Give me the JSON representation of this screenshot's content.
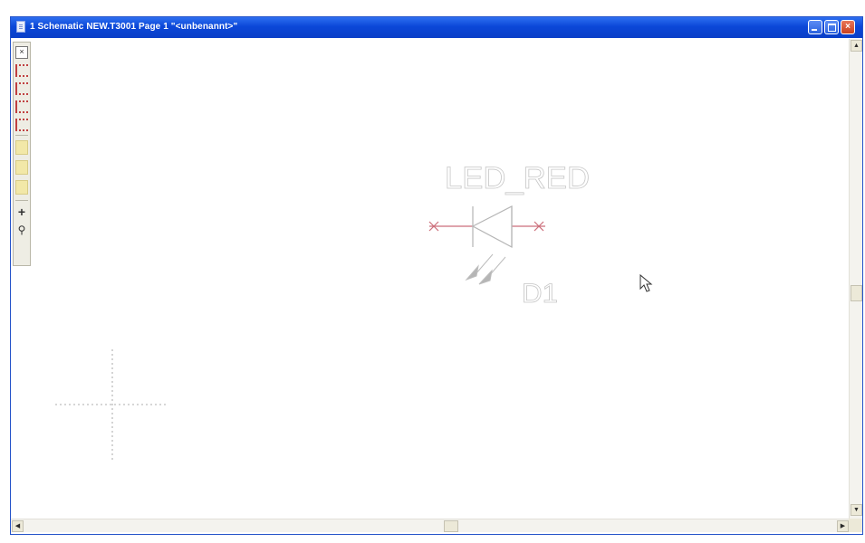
{
  "window": {
    "title": "1 Schematic NEW.T3001 Page 1 \"<unbenannt>\""
  },
  "window_controls": {
    "close_glyph": "×"
  },
  "toolbar": {
    "close_glyph": "×",
    "items": [
      "close-icon",
      "wire-tool-icon",
      "bus-tool-icon",
      "junction-tool-icon",
      "label-tool-icon",
      "text-tool-icon",
      "polygon-tool-icon",
      "add-part-icon",
      "search-part-icon"
    ]
  },
  "schematic": {
    "component_value": "LED_RED",
    "component_reference": "D1",
    "component_type": "LED",
    "accent_colors": {
      "pin": "#cc6e7a",
      "text": "#b9b9b9",
      "cursor_marker": "#bdbdbd"
    }
  },
  "scrollbars": {
    "up_arrow": "▲",
    "down_arrow": "▼",
    "left_arrow": "◀",
    "right_arrow": "▶"
  }
}
